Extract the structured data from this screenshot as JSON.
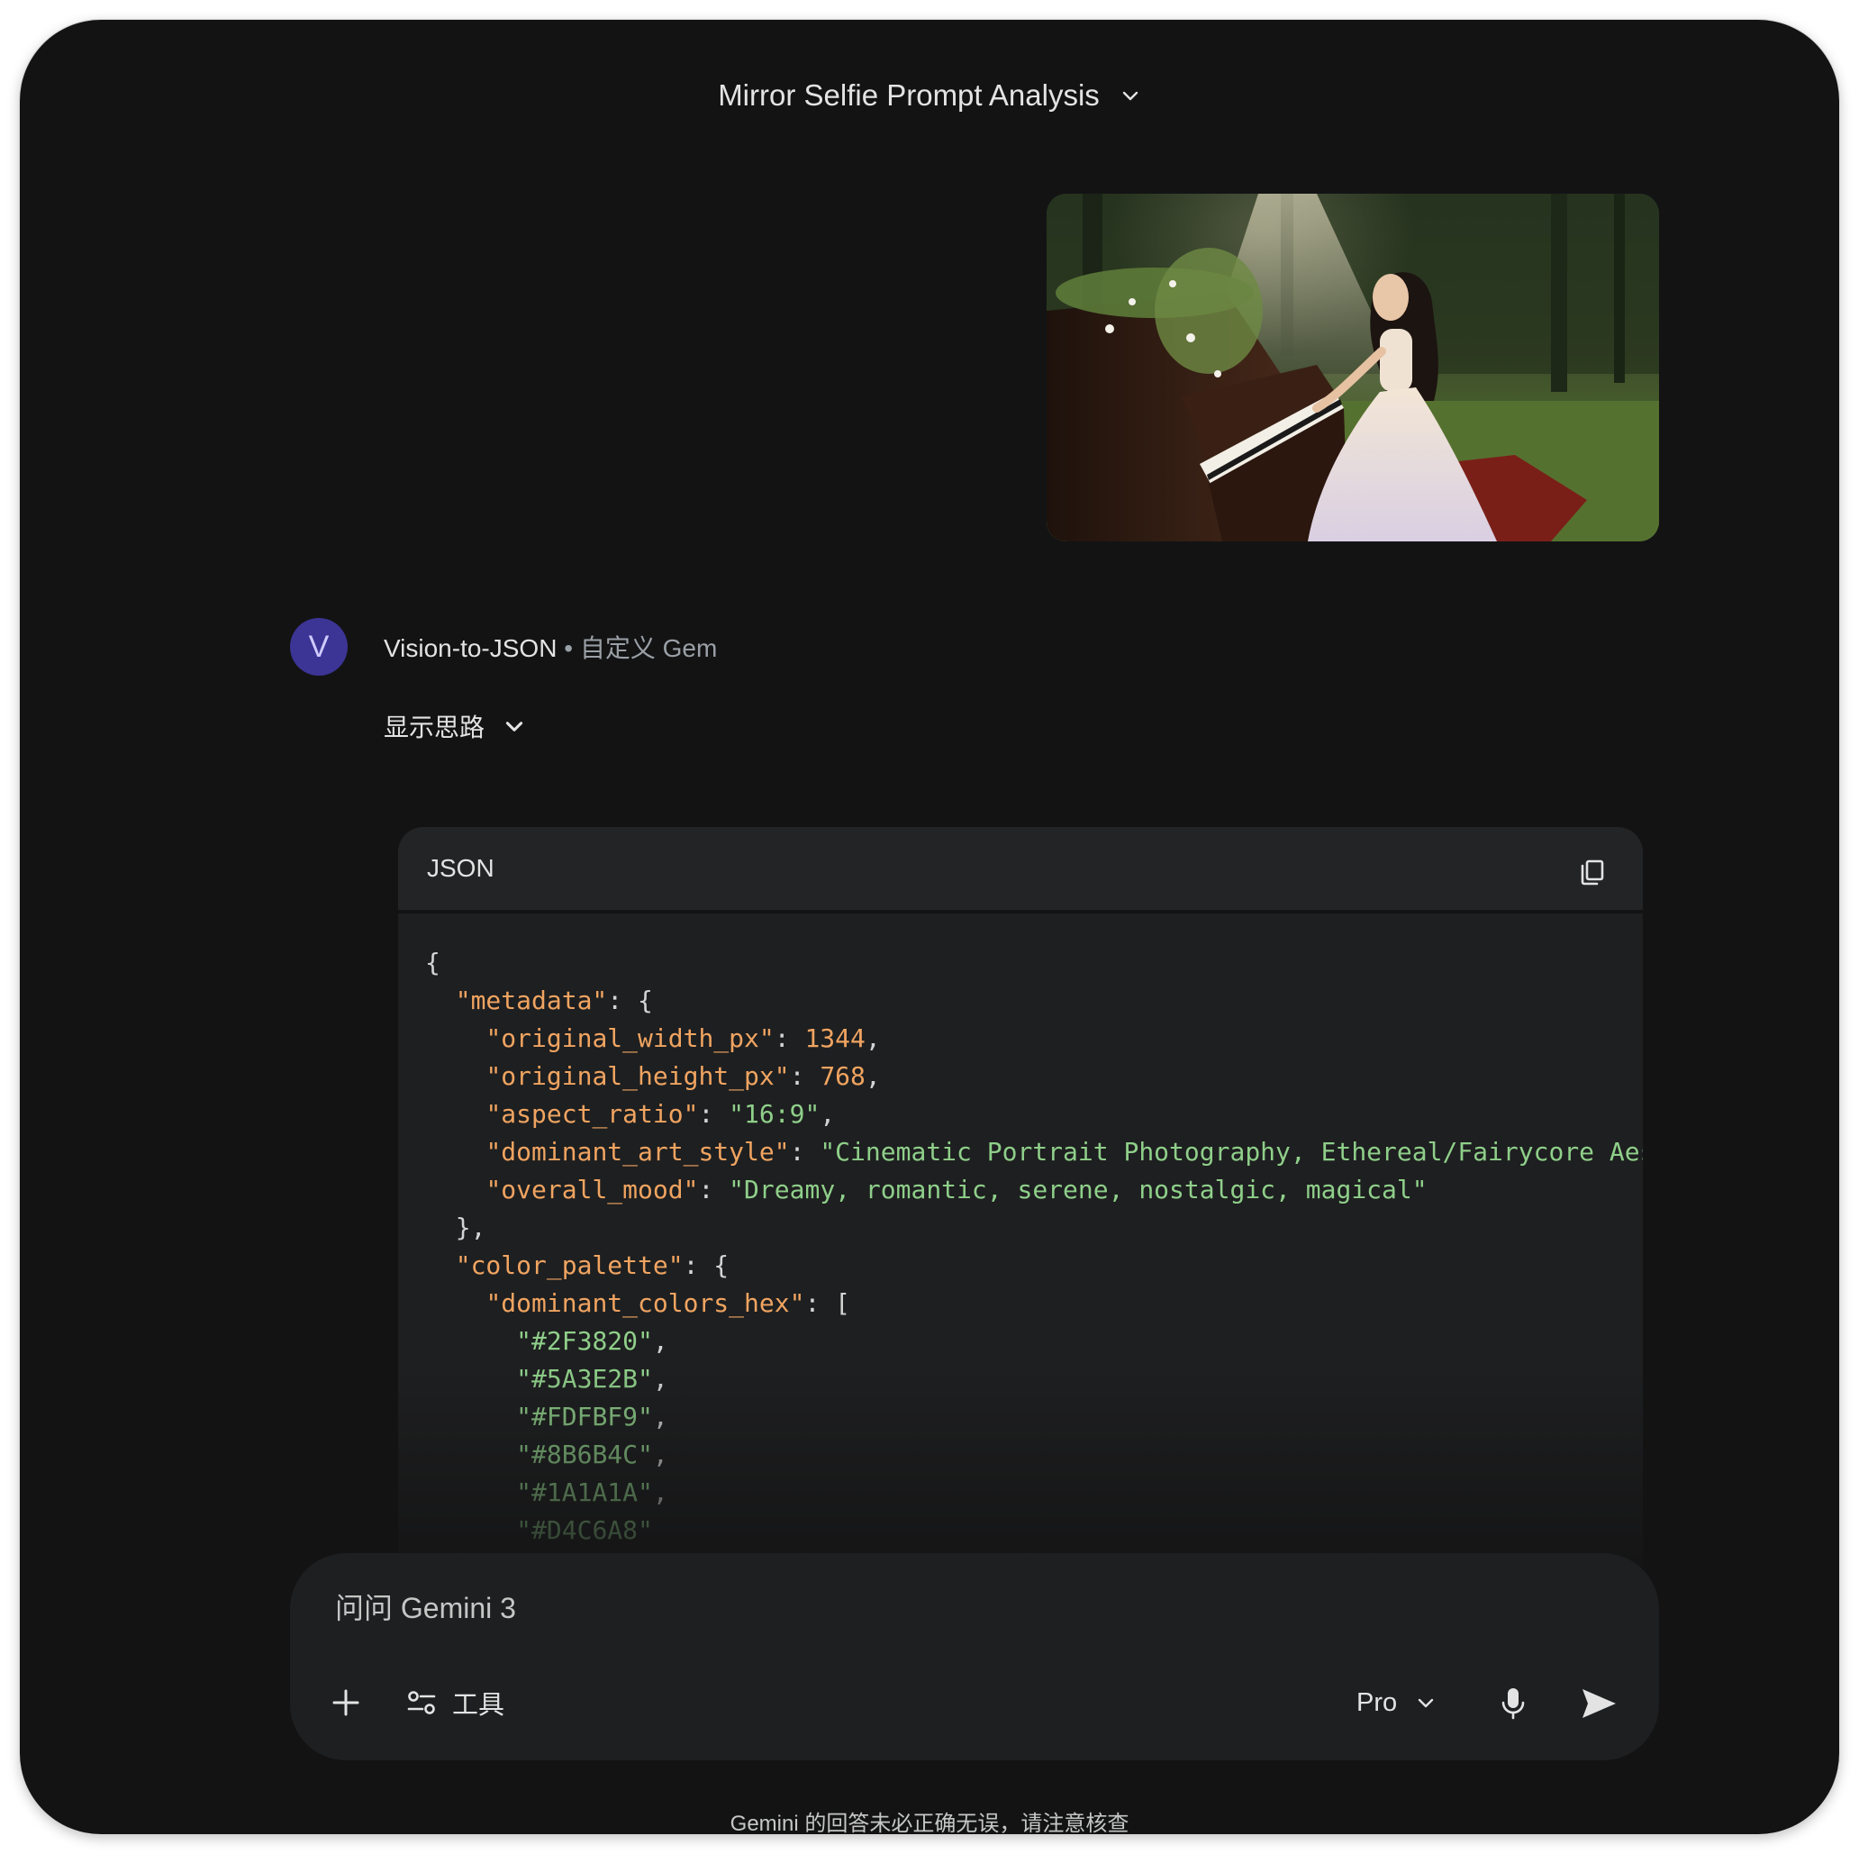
{
  "header": {
    "title": "Mirror Selfie Prompt Analysis"
  },
  "message": {
    "gem_avatar_letter": "V",
    "gem_name": "Vision-to-JSON",
    "gem_separator": " • ",
    "gem_type": "自定义 Gem",
    "thinking_label": "显示思路"
  },
  "code_block": {
    "language": "JSON",
    "lines": [
      [
        {
          "t": "p",
          "v": "{"
        }
      ],
      [
        {
          "t": "p",
          "v": "  "
        },
        {
          "t": "k",
          "v": "\"metadata\""
        },
        {
          "t": "p",
          "v": ": {"
        }
      ],
      [
        {
          "t": "p",
          "v": "    "
        },
        {
          "t": "k",
          "v": "\"original_width_px\""
        },
        {
          "t": "p",
          "v": ": "
        },
        {
          "t": "n",
          "v": "1344"
        },
        {
          "t": "p",
          "v": ","
        }
      ],
      [
        {
          "t": "p",
          "v": "    "
        },
        {
          "t": "k",
          "v": "\"original_height_px\""
        },
        {
          "t": "p",
          "v": ": "
        },
        {
          "t": "n",
          "v": "768"
        },
        {
          "t": "p",
          "v": ","
        }
      ],
      [
        {
          "t": "p",
          "v": "    "
        },
        {
          "t": "k",
          "v": "\"aspect_ratio\""
        },
        {
          "t": "p",
          "v": ": "
        },
        {
          "t": "s",
          "v": "\"16:9\""
        },
        {
          "t": "p",
          "v": ","
        }
      ],
      [
        {
          "t": "p",
          "v": "    "
        },
        {
          "t": "k",
          "v": "\"dominant_art_style\""
        },
        {
          "t": "p",
          "v": ": "
        },
        {
          "t": "s",
          "v": "\"Cinematic Portrait Photography, Ethereal/Fairycore Aes"
        }
      ],
      [
        {
          "t": "p",
          "v": "    "
        },
        {
          "t": "k",
          "v": "\"overall_mood\""
        },
        {
          "t": "p",
          "v": ": "
        },
        {
          "t": "s",
          "v": "\"Dreamy, romantic, serene, nostalgic, magical\""
        }
      ],
      [
        {
          "t": "p",
          "v": "  },"
        }
      ],
      [
        {
          "t": "p",
          "v": "  "
        },
        {
          "t": "k",
          "v": "\"color_palette\""
        },
        {
          "t": "p",
          "v": ": {"
        }
      ],
      [
        {
          "t": "p",
          "v": "    "
        },
        {
          "t": "k",
          "v": "\"dominant_colors_hex\""
        },
        {
          "t": "p",
          "v": ": ["
        }
      ],
      [
        {
          "t": "p",
          "v": "      "
        },
        {
          "t": "s",
          "v": "\"#2F3820\""
        },
        {
          "t": "p",
          "v": ","
        }
      ],
      [
        {
          "t": "p",
          "v": "      "
        },
        {
          "t": "s",
          "v": "\"#5A3E2B\""
        },
        {
          "t": "p",
          "v": ","
        }
      ],
      [
        {
          "t": "p",
          "v": "      "
        },
        {
          "t": "s",
          "v": "\"#FDFBF9\""
        },
        {
          "t": "p",
          "v": ","
        }
      ],
      [
        {
          "t": "p",
          "v": "      "
        },
        {
          "t": "s",
          "v": "\"#8B6B4C\""
        },
        {
          "t": "p",
          "v": ","
        }
      ],
      [
        {
          "t": "p",
          "v": "      "
        },
        {
          "t": "s",
          "v": "\"#1A1A1A\""
        },
        {
          "t": "p",
          "v": ","
        }
      ],
      [
        {
          "t": "p",
          "v": "      "
        },
        {
          "t": "s",
          "v": "\"#D4C6A8\""
        }
      ]
    ]
  },
  "composer": {
    "placeholder": "问问 Gemini 3",
    "tools_label": "工具",
    "model_label": "Pro"
  },
  "footer": {
    "disclaimer": "Gemini 的回答未必正确无误，请注意核查"
  },
  "colors": {
    "background": "#131314",
    "surface": "#1e1f20",
    "text": "#e3e3e3",
    "muted_text": "#9aa0a6",
    "json_key": "#f0a461",
    "json_string": "#8fcf8a",
    "avatar_bg": "#3c3595"
  },
  "icons": {
    "title_dropdown": "chevron-down-icon",
    "thinking_toggle": "chevron-down-icon",
    "copy": "copy-icon",
    "add": "plus-icon",
    "tools": "tune-icon",
    "model_dropdown": "chevron-down-icon",
    "microphone": "mic-icon",
    "send": "send-icon"
  }
}
